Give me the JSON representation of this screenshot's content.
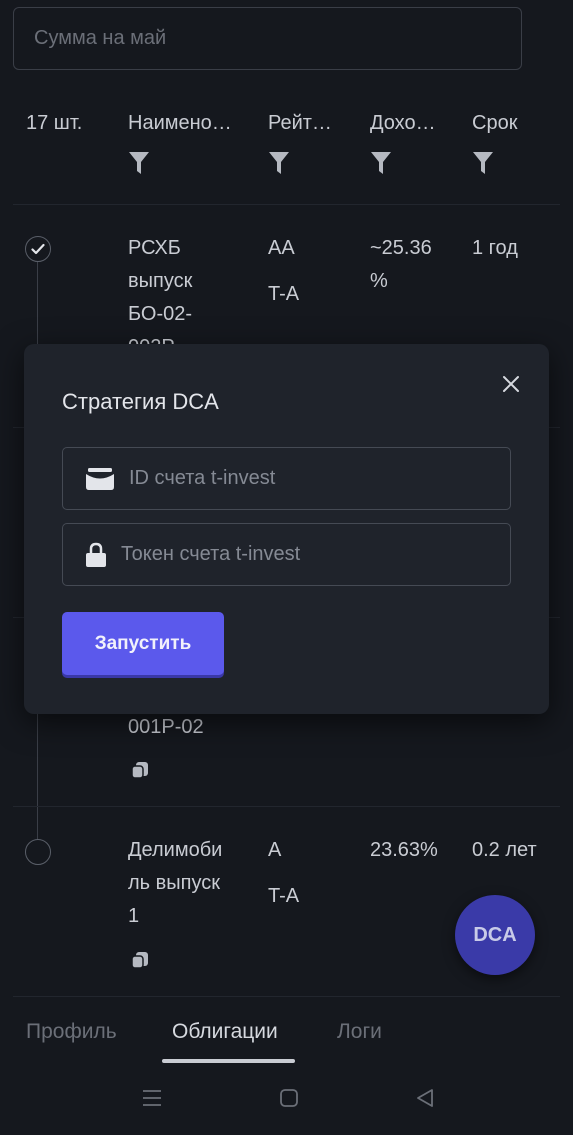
{
  "search": {
    "placeholder": "Сумма на май"
  },
  "table": {
    "count": "17 шт.",
    "columns": [
      "Наимено…",
      "Рейт…",
      "Дохо…",
      "Срок"
    ],
    "rows": [
      {
        "name_lines": [
          "РСХБ",
          "выпуск",
          "БО-02-",
          "002Р"
        ],
        "rating": "AA",
        "rating2": "T-A",
        "yield_lines": [
          "~25.36",
          "%"
        ],
        "term": "1 год",
        "checked": true
      },
      {
        "name_lines": [
          "001P-02"
        ],
        "checked": false
      },
      {
        "name_lines": [
          "Делимоби",
          "ль выпуск",
          "1"
        ],
        "rating": "A",
        "rating2": "T-A",
        "yield_lines": [
          "23.63%"
        ],
        "term": "0.2 лет",
        "checked": false
      }
    ]
  },
  "modal": {
    "title": "Стратегия DCA",
    "account_id_placeholder": "ID счета t-invest",
    "token_placeholder": "Токен счета t-invest",
    "run_label": "Запустить"
  },
  "fab": {
    "label": "DCA"
  },
  "tabs": [
    {
      "label": "Профиль",
      "active": false
    },
    {
      "label": "Облигации",
      "active": true
    },
    {
      "label": "Логи",
      "active": false
    }
  ],
  "colors": {
    "accent": "#5b59ec",
    "background": "#15181e",
    "modal": "#1f232b"
  }
}
